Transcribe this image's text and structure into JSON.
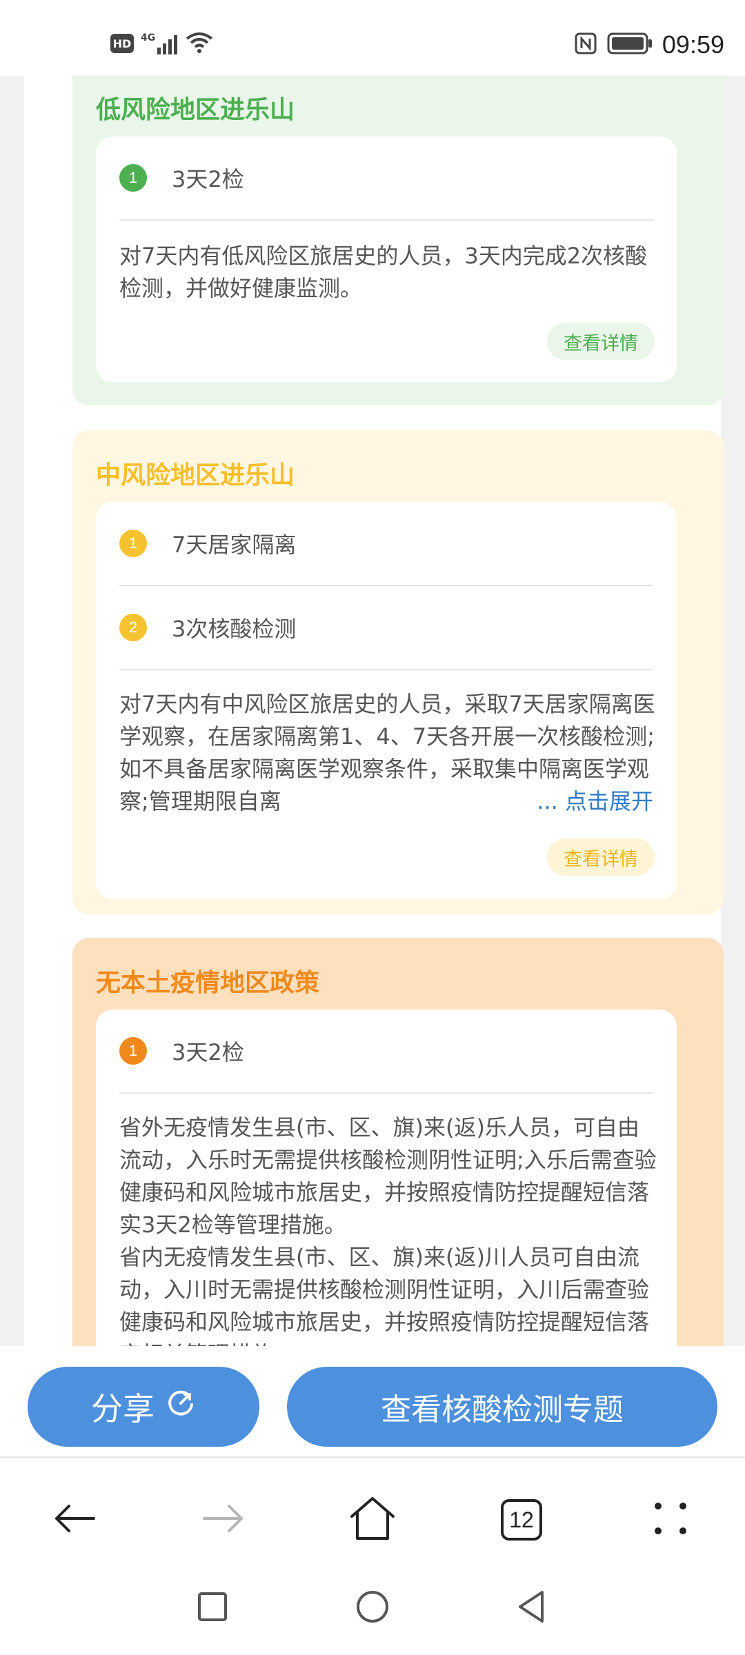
{
  "status_bar": {
    "hd_label": "HD",
    "network_label": "4G",
    "time": "09:59"
  },
  "sections": {
    "low_risk": {
      "title": "低风险地区进乐山",
      "items": [
        {
          "number": "1",
          "label": "3天2检"
        }
      ],
      "description": "对7天内有低风险区旅居史的人员，3天内完成2次核酸检测，并做好健康监测。",
      "detail_label": "查看详情",
      "color": "#4caf50"
    },
    "medium_risk": {
      "title": "中风险地区进乐山",
      "items": [
        {
          "number": "1",
          "label": "7天居家隔离"
        },
        {
          "number": "2",
          "label": "3次核酸检测"
        }
      ],
      "description": "对7天内有中风险区旅居史的人员，采取7天居家隔离医学观察，在居家隔离第1、4、7天各开展一次核酸检测;如不具备居家隔离医学观察条件，采取集中隔离医学观察;管理期限自离",
      "expand_label": "... 点击展开",
      "detail_label": "查看详情",
      "color": "#f7be2a"
    },
    "no_local": {
      "title": "无本土疫情地区政策",
      "items": [
        {
          "number": "1",
          "label": "3天2检"
        }
      ],
      "description_1": "省外无疫情发生县(市、区、旗)来(返)乐人员，可自由流动，入乐时无需提供核酸检测阴性证明;入乐后需查验健康码和风险城市旅居史，并按照疫情防控提醒短信落实3天2检等管理措施。",
      "description_2": "省内无疫情发生县(市、区、旗)来(返)川人员可自由流动，入川时无需提供核酸检测阴性证明，入川后需查验健康码和风险城市旅居史，并按照疫情防控提醒短信落实相关管理措施。",
      "color": "#f0891c"
    }
  },
  "actions": {
    "share_label": "分享",
    "topic_label": "查看核酸检测专题"
  },
  "browser_nav": {
    "tab_count": "12"
  }
}
